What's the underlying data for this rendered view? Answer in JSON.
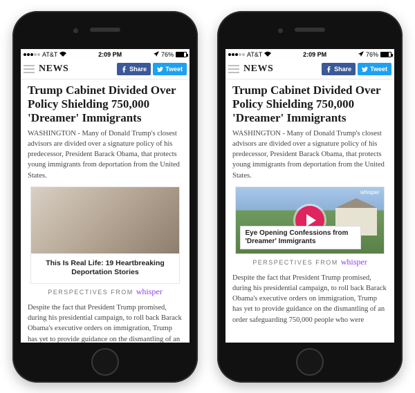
{
  "statusbar": {
    "carrier": "AT&T",
    "time": "2:09 PM",
    "battery_pct": "76%"
  },
  "appbar": {
    "title": "NEWS",
    "share_label": "Share",
    "tweet_label": "Tweet"
  },
  "article": {
    "headline": "Trump Cabinet Divided Over Policy Shielding 750,000 'Dreamer' Immigrants",
    "lede": "WASHINGTON - Many of Donald Trump's closest advisors are divided over a signature policy of his predecessor, President Barack Obama, that protects young immigrants from deportation from the United States.",
    "body2": "Despite the fact that President Trump promised, during his presidential campaign, to roll back Barack Obama's executive orders on immigration, Trump has yet to provide guidance on the dismantling of an order safeguarding 750,000 people who were"
  },
  "promo_left": {
    "caption": "This Is Real Life: 19 Heartbreaking Deportation Stories",
    "perspectives_prefix": "PERSPECTIVES FROM",
    "brand": "whisper"
  },
  "promo_right": {
    "overlay": "Eye Opening Confessions from 'Dreamer' Immigrants",
    "tag": "whisper",
    "perspectives_prefix": "PERSPECTIVES FROM",
    "brand": "whisper"
  }
}
